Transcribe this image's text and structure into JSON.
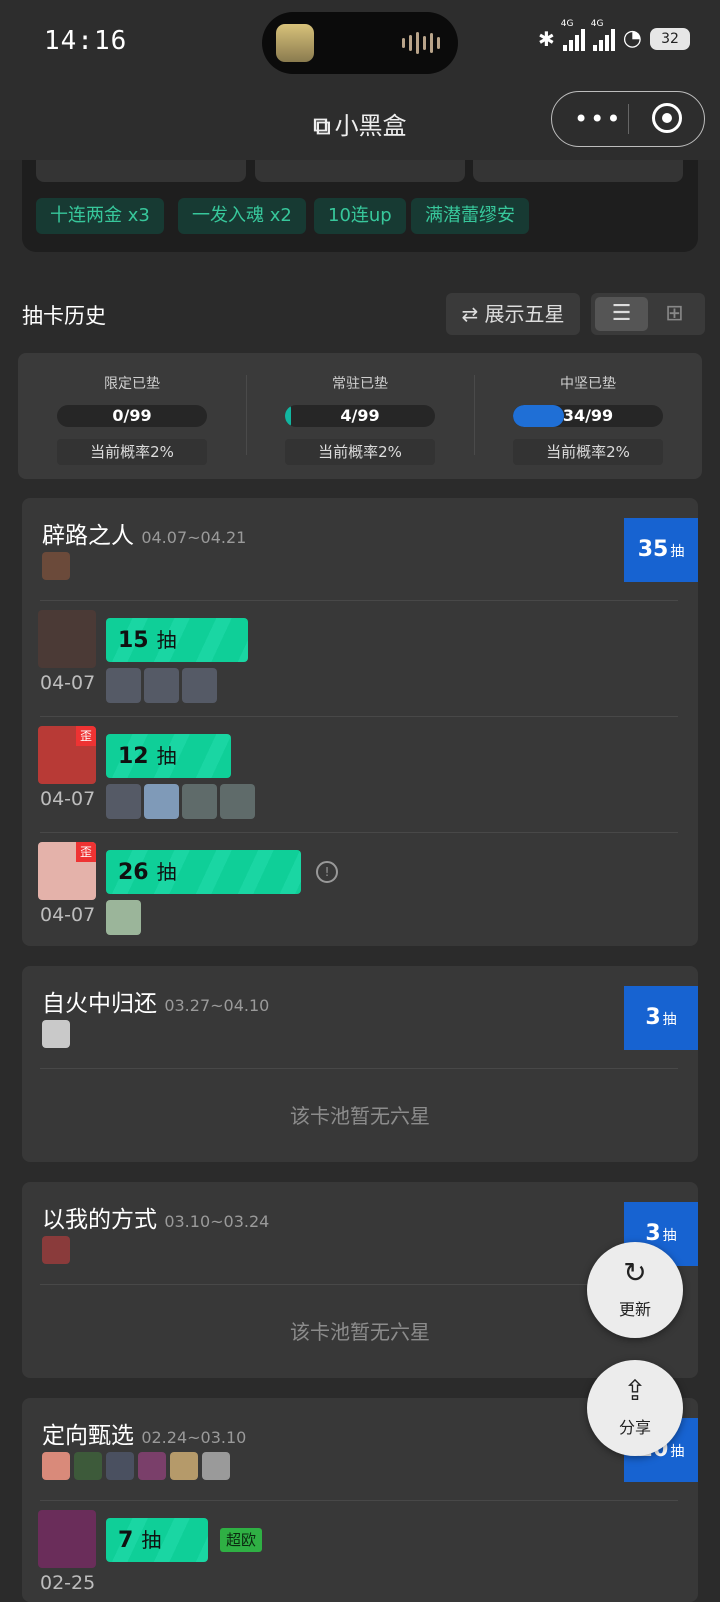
{
  "status": {
    "time": "14:16",
    "net1": "4G",
    "net2": "4G",
    "battery": "32"
  },
  "nav": {
    "title": "小黑盒",
    "more_icon": "more-dots-icon",
    "close_icon": "target-icon"
  },
  "tags": [
    "十连两金 x3",
    "一发入魂 x2",
    "10连up",
    "满潜蕾缪安"
  ],
  "history": {
    "title": "抽卡历史",
    "show_five_star": "⇄ 展示五星"
  },
  "pity": [
    {
      "label": "限定已垫",
      "value": "0/99",
      "fraction": 0.0,
      "rate": "当前概率2%"
    },
    {
      "label": "常驻已垫",
      "value": "4/99",
      "fraction": 0.04,
      "rate": "当前概率2%"
    },
    {
      "label": "中坚已垫",
      "value": "34/99",
      "fraction": 0.343,
      "rate": "当前概率2%"
    }
  ],
  "pools": [
    {
      "name": "辟路之人",
      "date": "04.07~04.21",
      "count": "35",
      "unit": "抽",
      "records": [
        {
          "pulls": "15",
          "unit": "抽",
          "date": "04-07",
          "wai": "",
          "fraction": 0.43
        },
        {
          "pulls": "12",
          "unit": "抽",
          "date": "04-07",
          "wai": "歪",
          "fraction": 0.38
        },
        {
          "pulls": "26",
          "unit": "抽",
          "date": "04-07",
          "wai": "歪",
          "fraction": 0.59
        }
      ]
    },
    {
      "name": "自火中归还",
      "date": "03.27~04.10",
      "count": "3",
      "unit": "抽",
      "empty": "该卡池暂无六星"
    },
    {
      "name": "以我的方式",
      "date": "03.10~03.24",
      "count": "3",
      "unit": "抽",
      "empty": "该卡池暂无六星"
    },
    {
      "name": "定向甄选",
      "date": "02.24~03.10",
      "count": "20",
      "unit": "抽",
      "records": [
        {
          "pulls": "7",
          "unit": "抽",
          "date": "02-25",
          "tag": "超欧",
          "fraction": 0.31
        }
      ]
    }
  ],
  "fab": {
    "refresh": "更新",
    "share": "分享"
  },
  "colors": {
    "accent_blue": "#1763d1",
    "pull_green": "#0fcf98",
    "tag_text": "#37c79b"
  }
}
